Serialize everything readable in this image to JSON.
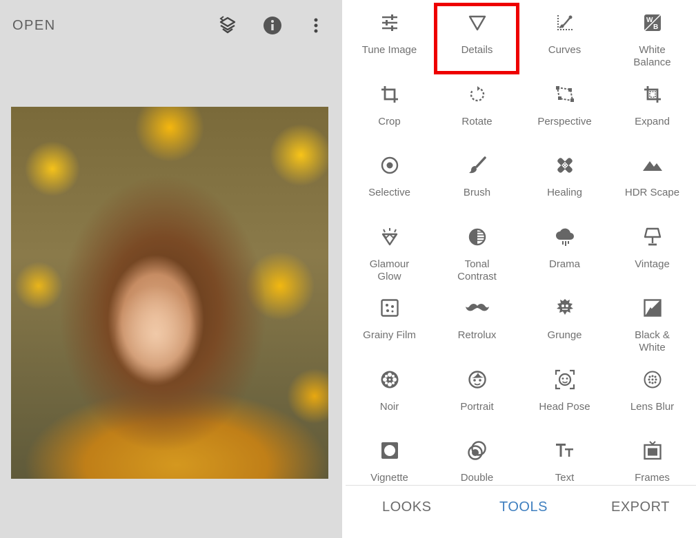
{
  "header": {
    "open_label": "OPEN",
    "icons": [
      "layers-icon",
      "info-icon",
      "more-vertical-icon"
    ]
  },
  "photo": {
    "description_icon": "photo-preview"
  },
  "highlight_color": "#ee0000",
  "tools": [
    {
      "label": "Tune Image",
      "icon": "tune-icon"
    },
    {
      "label": "Details",
      "icon": "details-triangle-icon"
    },
    {
      "label": "Curves",
      "icon": "curves-icon"
    },
    {
      "label": "White\nBalance",
      "icon": "white-balance-icon"
    },
    {
      "label": "Crop",
      "icon": "crop-icon"
    },
    {
      "label": "Rotate",
      "icon": "rotate-icon"
    },
    {
      "label": "Perspective",
      "icon": "perspective-icon"
    },
    {
      "label": "Expand",
      "icon": "expand-icon"
    },
    {
      "label": "Selective",
      "icon": "selective-icon"
    },
    {
      "label": "Brush",
      "icon": "brush-icon"
    },
    {
      "label": "Healing",
      "icon": "healing-icon"
    },
    {
      "label": "HDR Scape",
      "icon": "mountain-icon"
    },
    {
      "label": "Glamour\nGlow",
      "icon": "glamour-glow-icon"
    },
    {
      "label": "Tonal\nContrast",
      "icon": "tonal-contrast-icon"
    },
    {
      "label": "Drama",
      "icon": "cloud-icon"
    },
    {
      "label": "Vintage",
      "icon": "lamp-icon"
    },
    {
      "label": "Grainy Film",
      "icon": "grainy-film-icon"
    },
    {
      "label": "Retrolux",
      "icon": "mustache-icon"
    },
    {
      "label": "Grunge",
      "icon": "grunge-icon"
    },
    {
      "label": "Black &\nWhite",
      "icon": "black-white-icon"
    },
    {
      "label": "Noir",
      "icon": "film-reel-icon"
    },
    {
      "label": "Portrait",
      "icon": "face-icon"
    },
    {
      "label": "Head Pose",
      "icon": "head-pose-icon"
    },
    {
      "label": "Lens Blur",
      "icon": "lens-blur-icon"
    },
    {
      "label": "Vignette",
      "icon": "vignette-icon"
    },
    {
      "label": "Double",
      "icon": "double-exposure-icon"
    },
    {
      "label": "Text",
      "icon": "text-icon"
    },
    {
      "label": "Frames",
      "icon": "frames-icon"
    }
  ],
  "tabs": [
    {
      "label": "LOOKS",
      "active": false
    },
    {
      "label": "TOOLS",
      "active": true
    },
    {
      "label": "EXPORT",
      "active": false
    }
  ],
  "colors": {
    "active_tab": "#3f7fbf",
    "inactive_tab": "#6b6b6b",
    "icon": "#6a6a6a"
  }
}
